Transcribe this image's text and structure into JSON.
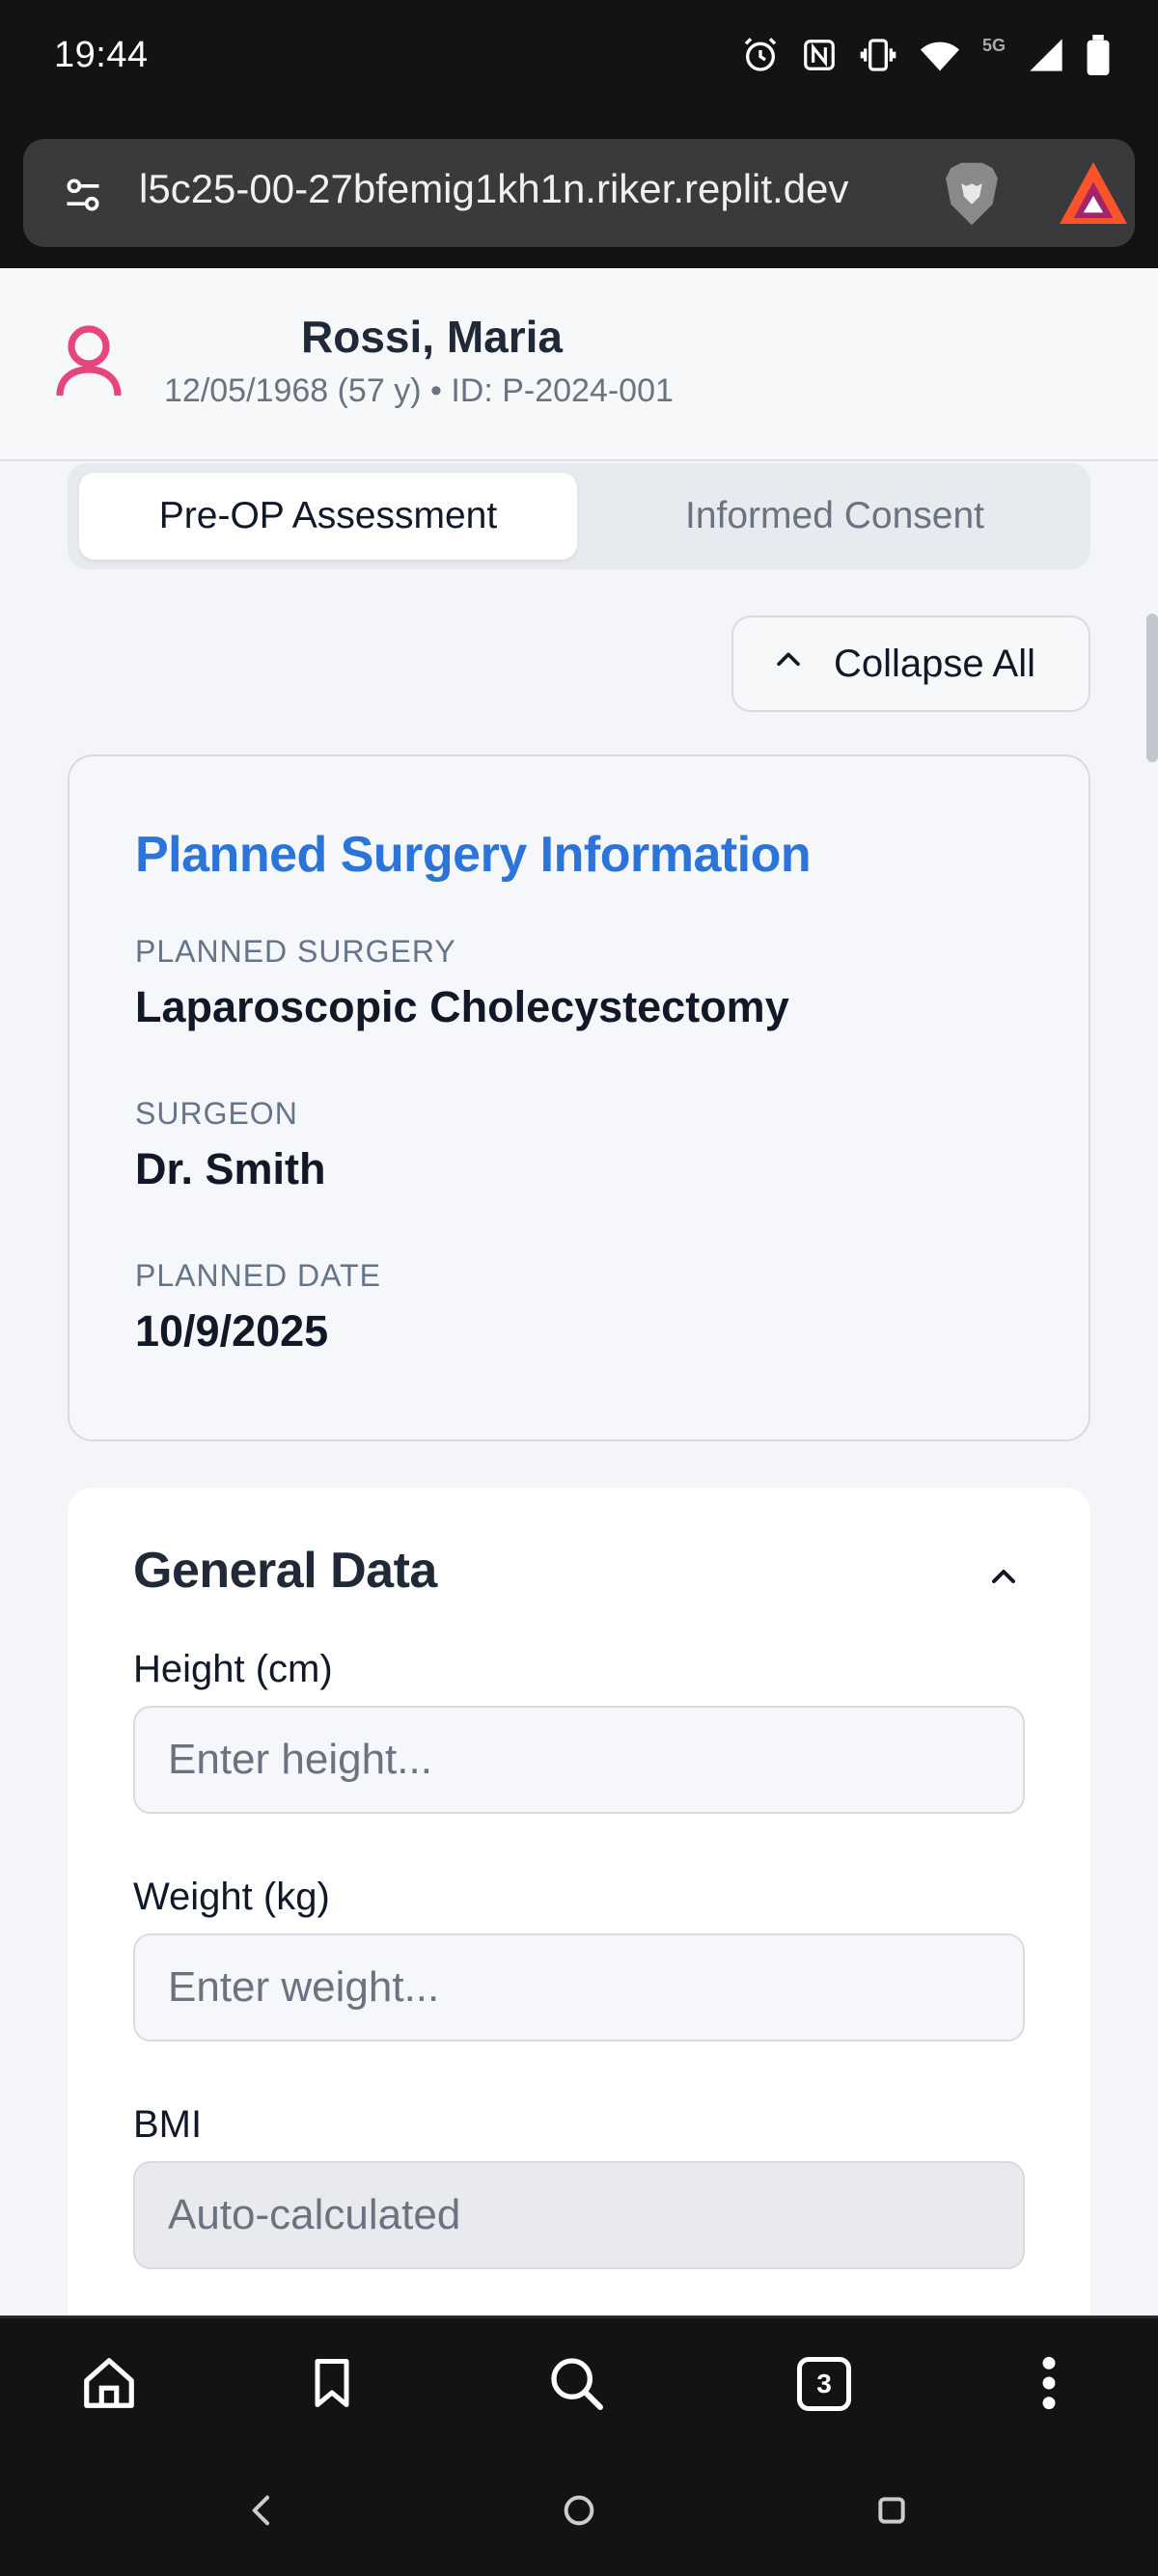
{
  "status_bar": {
    "time": "19:44",
    "network_label": "5G",
    "icons": [
      "alarm-icon",
      "nfc-icon",
      "vibrate-icon",
      "wifi-icon",
      "signal-icon",
      "battery-icon"
    ]
  },
  "browser": {
    "url": "l5c25-00-27bfemig1kh1n.riker.replit.dev",
    "tab_count": "3"
  },
  "patient": {
    "name": "Rossi, Maria",
    "meta": "12/05/1968 (57 y) • ID: P-2024-001"
  },
  "tabs": [
    {
      "label": "Pre-OP Assessment",
      "active": true
    },
    {
      "label": "Informed Consent",
      "active": false
    }
  ],
  "actions": {
    "collapse_label": "Collapse All"
  },
  "surgery_info": {
    "title": "Planned Surgery Information",
    "fields": [
      {
        "label": "PLANNED SURGERY",
        "value": "Laparoscopic Cholecystectomy"
      },
      {
        "label": "SURGEON",
        "value": "Dr. Smith"
      },
      {
        "label": "PLANNED DATE",
        "value": "10/9/2025"
      }
    ]
  },
  "general_data": {
    "title": "General Data",
    "fields": [
      {
        "label": "Height (cm)",
        "value": "",
        "placeholder": "Enter height..."
      },
      {
        "label": "Weight (kg)",
        "value": "",
        "placeholder": "Enter weight..."
      },
      {
        "label": "BMI",
        "value": "",
        "placeholder": "Auto-calculated"
      }
    ]
  },
  "colors": {
    "accent": "#2b74d9",
    "avatar": "#e6457e",
    "page_bg": "#f3f5f8"
  }
}
